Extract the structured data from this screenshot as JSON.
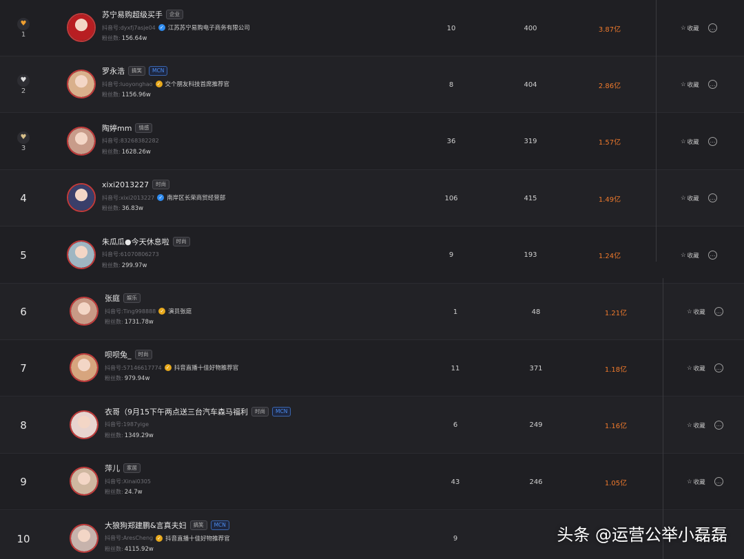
{
  "rows": [
    {
      "rank": "1",
      "medal": "gold",
      "name": "苏宁易购超级买手",
      "tags": [
        {
          "label": "企业",
          "type": "normal"
        }
      ],
      "id_label": "抖音号:",
      "id": "dyxfj7asje04",
      "verify_type": "blue",
      "verify_text": "江苏苏宁易购电子商务有限公司",
      "fans_label": "粉丝数:",
      "fans": "156.64w",
      "c1": "10",
      "c2": "400",
      "sales": "3.87亿",
      "fav_label": "收藏"
    },
    {
      "rank": "2",
      "medal": "silver",
      "name": "罗永浩",
      "tags": [
        {
          "label": "搞笑",
          "type": "normal"
        },
        {
          "label": "MCN",
          "type": "mcn"
        }
      ],
      "id_label": "抖音号:",
      "id": "luoyonghao",
      "verify_type": "gold",
      "verify_text": "交个朋友科技首席推荐官",
      "fans_label": "粉丝数:",
      "fans": "1156.96w",
      "c1": "8",
      "c2": "404",
      "sales": "2.86亿",
      "fav_label": "收藏"
    },
    {
      "rank": "3",
      "medal": "bronze",
      "name": "陶婷mm",
      "tags": [
        {
          "label": "情感",
          "type": "normal"
        }
      ],
      "id_label": "抖音号:",
      "id": "83268382282",
      "verify_type": "",
      "verify_text": "",
      "fans_label": "粉丝数:",
      "fans": "1628.26w",
      "c1": "36",
      "c2": "319",
      "sales": "1.57亿",
      "fav_label": "收藏"
    },
    {
      "rank": "4",
      "medal": "",
      "name": "xixi2013227",
      "tags": [
        {
          "label": "时尚",
          "type": "normal"
        }
      ],
      "id_label": "抖音号:",
      "id": "xixi2013227",
      "verify_type": "blue",
      "verify_text": "南岸区长荣商贸经营部",
      "fans_label": "粉丝数:",
      "fans": "36.83w",
      "c1": "106",
      "c2": "415",
      "sales": "1.49亿",
      "fav_label": "收藏"
    },
    {
      "rank": "5",
      "medal": "",
      "name": "朱瓜瓜●今天休息啦",
      "tags": [
        {
          "label": "时尚",
          "type": "normal"
        }
      ],
      "id_label": "抖音号:",
      "id": "61070806273",
      "verify_type": "",
      "verify_text": "",
      "fans_label": "粉丝数:",
      "fans": "299.97w",
      "c1": "9",
      "c2": "193",
      "sales": "1.24亿",
      "fav_label": "收藏"
    },
    {
      "rank": "6",
      "medal": "",
      "name": "张庭",
      "tags": [
        {
          "label": "娱乐",
          "type": "normal"
        }
      ],
      "id_label": "抖音号:",
      "id": "Ting998888",
      "verify_type": "gold",
      "verify_text": "演员张庭",
      "fans_label": "粉丝数:",
      "fans": "1731.78w",
      "c1": "1",
      "c2": "48",
      "sales": "1.21亿",
      "fav_label": "收藏"
    },
    {
      "rank": "7",
      "medal": "",
      "name": "呗呗兔_",
      "tags": [
        {
          "label": "时尚",
          "type": "normal"
        }
      ],
      "id_label": "抖音号:",
      "id": "57146617774",
      "verify_type": "gold",
      "verify_text": "抖音直播十佳好物推荐官",
      "fans_label": "粉丝数:",
      "fans": "979.94w",
      "c1": "11",
      "c2": "371",
      "sales": "1.18亿",
      "fav_label": "收藏"
    },
    {
      "rank": "8",
      "medal": "",
      "name": "衣哥（9月15下午两点送三台汽车森马福利",
      "tags": [
        {
          "label": "时尚",
          "type": "normal"
        },
        {
          "label": "MCN",
          "type": "mcn"
        }
      ],
      "id_label": "抖音号:",
      "id": "1987yige",
      "verify_type": "",
      "verify_text": "",
      "fans_label": "粉丝数:",
      "fans": "1349.29w",
      "c1": "6",
      "c2": "249",
      "sales": "1.16亿",
      "fav_label": "收藏"
    },
    {
      "rank": "9",
      "medal": "",
      "name": "萍儿",
      "tags": [
        {
          "label": "家居",
          "type": "normal"
        }
      ],
      "id_label": "抖音号:",
      "id": "Xinai0305",
      "verify_type": "",
      "verify_text": "",
      "fans_label": "粉丝数:",
      "fans": "24.7w",
      "c1": "43",
      "c2": "246",
      "sales": "1.05亿",
      "fav_label": "收藏"
    },
    {
      "rank": "10",
      "medal": "",
      "name": "大狼狗郑建鹏&言真夫妇",
      "tags": [
        {
          "label": "搞笑",
          "type": "normal"
        },
        {
          "label": "MCN",
          "type": "mcn"
        }
      ],
      "id_label": "抖音号:",
      "id": "AresCheng",
      "verify_type": "gold",
      "verify_text": "抖音直播十佳好物推荐官",
      "fans_label": "粉丝数:",
      "fans": "4115.92w",
      "c1": "9",
      "c2": "",
      "sales": "",
      "fav_label": ""
    }
  ],
  "icons": {
    "star": "star-outline-icon",
    "more": "more-circle-icon",
    "verified": "verified-check-icon",
    "medal": "heart-medal-icon"
  },
  "colors": {
    "sales": "#f07a2c",
    "mcn": "#4c8df0",
    "gold_medal": "#f0a030",
    "silver_medal": "#e0e0e0",
    "bronze_medal": "#d8c08a",
    "avatar_ring": "#c23b3b"
  },
  "watermark": {
    "brand": "头条",
    "handle": "@运营公举小磊磊"
  }
}
